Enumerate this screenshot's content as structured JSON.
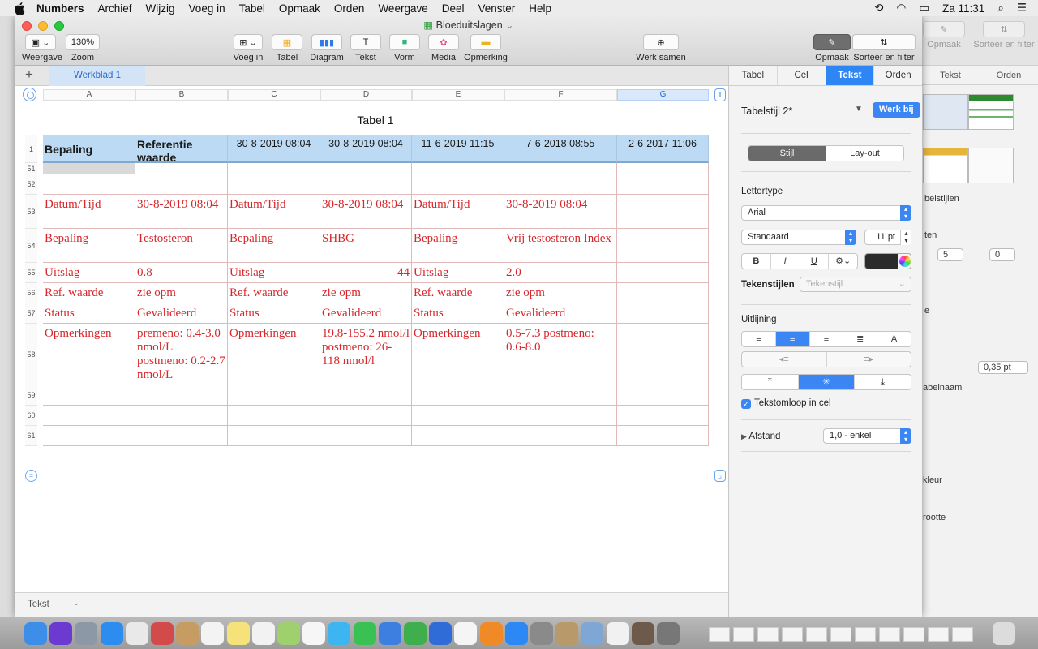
{
  "menubar": {
    "app": "Numbers",
    "items": [
      "Archief",
      "Wijzig",
      "Voeg in",
      "Tabel",
      "Opmaak",
      "Orden",
      "Weergave",
      "Deel",
      "Venster",
      "Help"
    ],
    "clock": "Za 11:31"
  },
  "window": {
    "title": "Bloeduitslagen",
    "zoom": "130%",
    "toolbar": {
      "view": "Weergave",
      "zoom": "Zoom",
      "insert": "Voeg in",
      "table": "Tabel",
      "chart": "Diagram",
      "text": "Tekst",
      "shape": "Vorm",
      "media": "Media",
      "comment": "Opmerking",
      "collaborate": "Werk samen",
      "format": "Opmaak",
      "sort": "Sorteer en filter"
    }
  },
  "sheet": {
    "tab": "Werkblad 1",
    "add": "+"
  },
  "table": {
    "title": "Tabel 1",
    "columns": [
      "A",
      "B",
      "C",
      "D",
      "E",
      "F",
      "G"
    ],
    "header_row_num": "1",
    "headers": [
      "Bepaling",
      "Referentie waarde",
      "30-8-2019 08:04",
      "30-8-2019 08:04",
      "11-6-2019 11:15",
      "7-6-2018 08:55",
      "2-6-2017 11:06"
    ],
    "rows": [
      {
        "num": "51",
        "cells": [
          "",
          "",
          "",
          "",
          "",
          "",
          ""
        ]
      },
      {
        "num": "52",
        "cells": [
          "",
          "",
          "",
          "",
          "",
          "",
          ""
        ]
      },
      {
        "num": "53",
        "cells": [
          "Datum/Tijd",
          "30-8-2019 08:04",
          "Datum/Tijd",
          "30-8-2019 08:04",
          "Datum/Tijd",
          "30-8-2019 08:04",
          ""
        ]
      },
      {
        "num": "54",
        "cells": [
          "Bepaling",
          "Testosteron",
          "Bepaling",
          "SHBG",
          "Bepaling",
          "Vrij testosteron Index",
          ""
        ]
      },
      {
        "num": "55",
        "cells": [
          "Uitslag",
          "0.8",
          "Uitslag",
          "44",
          "Uitslag",
          "2.0",
          ""
        ]
      },
      {
        "num": "56",
        "cells": [
          "Ref. waarde",
          "zie opm",
          "Ref. waarde",
          "zie opm",
          "Ref. waarde",
          "zie opm",
          ""
        ]
      },
      {
        "num": "57",
        "cells": [
          "Status",
          "Gevalideerd",
          "Status",
          "Gevalideerd",
          "Status",
          "Gevalideerd",
          ""
        ]
      },
      {
        "num": "58",
        "cells": [
          "Opmerkingen",
          "premeno: 0.4-3.0 nmol/L postmeno: 0.2-2.7 nmol/L",
          "Opmerkingen",
          "19.8-155.2 nmol/l postmeno: 26-118 nmol/l",
          "Opmerkingen",
          "0.5-7.3 postmeno: 0.6-8.0",
          ""
        ]
      },
      {
        "num": "59",
        "cells": [
          "",
          "",
          "",
          "",
          "",
          "",
          ""
        ]
      },
      {
        "num": "60",
        "cells": [
          "",
          "",
          "",
          "",
          "",
          "",
          ""
        ]
      },
      {
        "num": "61",
        "cells": [
          "",
          "",
          "",
          "",
          "",
          "",
          ""
        ]
      }
    ]
  },
  "statusbar": {
    "label": "Tekst",
    "value": "-"
  },
  "inspector": {
    "tabs": [
      "Tabel",
      "Cel",
      "Tekst",
      "Orden"
    ],
    "active_tab": "Tekst",
    "style_name": "Tabelstijl 2*",
    "update_button": "Werk bij",
    "subtabs": [
      "Stijl",
      "Lay-out"
    ],
    "font_heading": "Lettertype",
    "font": "Arial",
    "font_style": "Standaard",
    "font_size": "11 pt",
    "bold": "B",
    "italic": "I",
    "underline": "U",
    "char_styles_label": "Tekenstijlen",
    "char_styles_placeholder": "Tekenstijl",
    "alignment_heading": "Uitlijning",
    "wrap_label": "Tekstomloop in cel",
    "spacing_label": "Afstand",
    "spacing_value": "1,0 - enkel",
    "text_color": "#2b2b2b"
  },
  "background_window": {
    "format": "Opmaak",
    "sort": "Sorteer en filter",
    "tabs": [
      "Tekst",
      "Orden"
    ],
    "texts": [
      "belstijlen",
      "ten",
      "5",
      "0",
      "e",
      "0,35 pt",
      "abelnaam",
      "kleur",
      "rootte"
    ]
  }
}
